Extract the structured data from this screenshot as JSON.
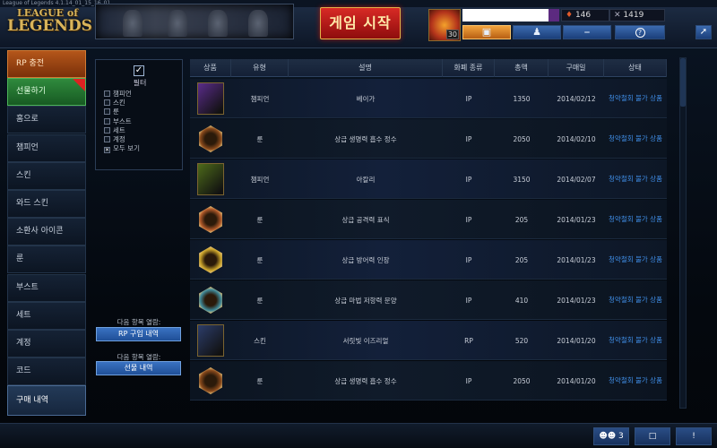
{
  "window": {
    "title": "League of Legends 4.1.14_01_15_16_01"
  },
  "header": {
    "logo_line1": "LEAGUE of",
    "logo_line2": "LEGENDS",
    "play_button": "게임 시작",
    "summoner_level": "30",
    "rp_balance": "146",
    "ip_balance": "1419",
    "rp_icon": "rp-gem-icon",
    "ip_icon": "ip-icon",
    "nav_icons": [
      "shop-icon",
      "profile-icon",
      "spellbook-icon",
      "help-icon"
    ],
    "help_glyph": "?",
    "pin_icon": "pin-icon"
  },
  "sidebar": {
    "items": [
      {
        "label": "RP 충전"
      },
      {
        "label": "선물하기"
      },
      {
        "label": "홈으로"
      },
      {
        "label": "챔피언"
      },
      {
        "label": "스킨"
      },
      {
        "label": "와드 스킨"
      },
      {
        "label": "소환사 아이콘"
      },
      {
        "label": "룬"
      },
      {
        "label": "부스트"
      },
      {
        "label": "세트"
      },
      {
        "label": "계정"
      },
      {
        "label": "코드"
      },
      {
        "label": "구매 내역"
      }
    ],
    "active_index": 12
  },
  "filter": {
    "title": "필터",
    "options": [
      {
        "label": "챔피언",
        "checked": false
      },
      {
        "label": "스킨",
        "checked": false
      },
      {
        "label": "룬",
        "checked": false
      },
      {
        "label": "부스트",
        "checked": false
      },
      {
        "label": "세트",
        "checked": false
      },
      {
        "label": "계정",
        "checked": false
      },
      {
        "label": "모두 보기",
        "checked": true
      }
    ]
  },
  "side_links": {
    "label1": "다음 항목 열람:",
    "button1": "RP 구입 내역",
    "label2": "다음 항목 열람:",
    "button2": "선물 내역"
  },
  "table": {
    "headers": [
      "상품",
      "유형",
      "설명",
      "화폐 종류",
      "총액",
      "구매일",
      "상태"
    ],
    "rows": [
      {
        "icon": "veigar-portrait-icon",
        "kind": "champ",
        "color": "#5a2c8a",
        "type": "챔피언",
        "desc": "베이가",
        "currency": "IP",
        "total": "1350",
        "date": "2014/02/12",
        "status": "청약철회 불가 상품"
      },
      {
        "icon": "quintessence-rune-icon",
        "kind": "rune",
        "color": "#8a4a1c",
        "type": "룬",
        "desc": "상급 생명력 흡수 정수",
        "currency": "IP",
        "total": "2050",
        "date": "2014/02/10",
        "status": "청약철회 불가 상품"
      },
      {
        "icon": "akali-portrait-icon",
        "kind": "champ",
        "color": "#4d6a1a",
        "type": "챔피언",
        "desc": "아칼리",
        "currency": "IP",
        "total": "3150",
        "date": "2014/02/07",
        "status": "청약철회 불가 상품"
      },
      {
        "icon": "mark-rune-icon",
        "kind": "rune",
        "color": "#b15a2a",
        "type": "룬",
        "desc": "상급 공격력 표식",
        "currency": "IP",
        "total": "205",
        "date": "2014/01/23",
        "status": "청약철회 불가 상품"
      },
      {
        "icon": "seal-rune-icon",
        "kind": "rune",
        "color": "#c9a22a",
        "type": "룬",
        "desc": "상급 방어력 인장",
        "currency": "IP",
        "total": "205",
        "date": "2014/01/23",
        "status": "청약철회 불가 상품"
      },
      {
        "icon": "glyph-rune-icon",
        "kind": "rune",
        "color": "#3f8a9a",
        "type": "룬",
        "desc": "상급 마법 저항력 문양",
        "currency": "IP",
        "total": "410",
        "date": "2014/01/23",
        "status": "청약철회 불가 상품"
      },
      {
        "icon": "ezreal-skin-icon",
        "kind": "champ",
        "color": "#2c3d6a",
        "type": "스킨",
        "desc": "서릿빛 이즈리얼",
        "currency": "RP",
        "total": "520",
        "date": "2014/01/20",
        "status": "청약철회 불가 상품"
      },
      {
        "icon": "quintessence-rune-icon",
        "kind": "rune",
        "color": "#8a4a1c",
        "type": "룬",
        "desc": "상급 생명력 흡수 정수",
        "currency": "IP",
        "total": "2050",
        "date": "2014/01/20",
        "status": "청약철회 불가 상품"
      }
    ]
  },
  "bottom": {
    "friends_count": "3",
    "friends_icon": "friends-icon",
    "chat_icon": "chat-icon",
    "alert_glyph": "!"
  }
}
